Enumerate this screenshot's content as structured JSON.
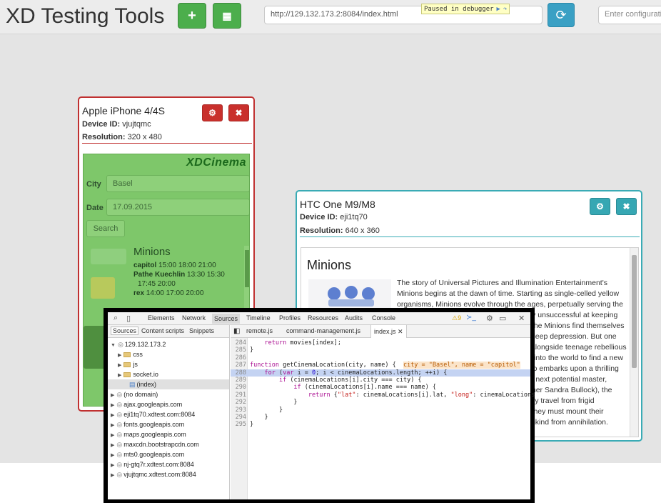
{
  "app": {
    "title": "XD Testing Tools",
    "add_icon": "+",
    "qr_icon": "▦",
    "url": "http://129.132.173.2:8084/index.html",
    "debug_badge": "Paused in debugger",
    "refresh_icon": "⟳",
    "config_placeholder": "Enter configuration"
  },
  "devices": [
    {
      "name": "Apple iPhone 4/4S",
      "device_id_label": "Device ID:",
      "device_id": "vjujtqmc",
      "resolution_label": "Resolution:",
      "resolution": "320 x 480",
      "accent": "#c03030"
    },
    {
      "name": "HTC One M9/M8",
      "device_id_label": "Device ID:",
      "device_id": "eji1tq70",
      "resolution_label": "Resolution:",
      "resolution": "640 x 360",
      "accent": "#3aabb5"
    }
  ],
  "cinema": {
    "logo": "XDCinema",
    "city_label": "City",
    "city_value": "Basel",
    "date_label": "Date",
    "date_value": "17.09.2015",
    "search_label": "Search",
    "movie_title": "Minions",
    "schedule": [
      {
        "venue": "capitol",
        "times": "15:00   18:00   21:00"
      },
      {
        "venue": "Pathe Kuechlin",
        "times": "13:30   15:30"
      },
      {
        "venue": "",
        "times": "17:45   20:00"
      },
      {
        "venue": "rex",
        "times": "14:00   17:00   20:00"
      }
    ]
  },
  "movie_detail": {
    "title": "Minions",
    "description": "The story of Universal Pictures and Illumination Entertainment's Minions begins at the dawn of time. Starting as single-celled yellow organisms, Minions evolve through the ages, perpetually serving the most despicable of masters. Continuously unsuccessful at keeping these masters—from T. rex to Napoleon-the Minions find themselves without someone to serve and fall into a deep depression. But one Minion named Kevin has a plan, and he-alongside teenage rebellious Stuart and lovable little Bob-ventures out into the world to find a new evil boss for his brethren to follow. The trio embarks upon a thrilling journey that ultimately leads them to their next potential master, Scarlet Overkill (Academy Award (R) winner Sandra Bullock), the world's first-ever female super-villain. They travel from frigid Antarctica to 1960s mod London, where they must mount their biggest challenge yet: saving all of Minionkind from annihilation."
  },
  "devtools": {
    "tabs": [
      "Elements",
      "Network",
      "Sources",
      "Timeline",
      "Profiles",
      "Resources",
      "Audits",
      "Console"
    ],
    "active_tab": "Sources",
    "warning_count": "9",
    "subtabs": [
      "Sources",
      "Content scripts",
      "Snippets"
    ],
    "file_tabs": [
      "remote.js",
      "command-management.js",
      "index.js"
    ],
    "active_file": "index.js",
    "tree": [
      {
        "label": "129.132.173.2",
        "level": 0,
        "type": "origin",
        "open": true
      },
      {
        "label": "css",
        "level": 1,
        "type": "folder"
      },
      {
        "label": "js",
        "level": 1,
        "type": "folder"
      },
      {
        "label": "socket.io",
        "level": 1,
        "type": "folder"
      },
      {
        "label": "(index)",
        "level": 1,
        "type": "file",
        "selected": true
      },
      {
        "label": "(no domain)",
        "level": 0,
        "type": "origin"
      },
      {
        "label": "ajax.googleapis.com",
        "level": 0,
        "type": "origin"
      },
      {
        "label": "eji1tq70.xdtest.com:8084",
        "level": 0,
        "type": "origin"
      },
      {
        "label": "fonts.googleapis.com",
        "level": 0,
        "type": "origin"
      },
      {
        "label": "maps.googleapis.com",
        "level": 0,
        "type": "origin"
      },
      {
        "label": "maxcdn.bootstrapcdn.com",
        "level": 0,
        "type": "origin"
      },
      {
        "label": "mts0.googleapis.com",
        "level": 0,
        "type": "origin"
      },
      {
        "label": "nj-gtq7r.xdtest.com:8084",
        "level": 0,
        "type": "origin"
      },
      {
        "label": "vjujtqmc.xdtest.com:8084",
        "level": 0,
        "type": "origin"
      }
    ],
    "code": [
      {
        "ln": "284",
        "html": "    <span class=\"kw\">return</span> movies[index];"
      },
      {
        "ln": "285",
        "html": "}"
      },
      {
        "ln": "286",
        "html": ""
      },
      {
        "ln": "287",
        "html": "<span class=\"kw\">function</span> getCinemaLocation(city, name) {  <span class=\"inl\">city = \"Basel\", name = \"capitol\"</span>"
      },
      {
        "ln": "288",
        "html": "    <span class=\"kw\">for</span> (<span class=\"kw\">var</span> i = <span class=\"fn\">0</span>; i &lt; cinemaLocations.length; ++i) {",
        "current": true
      },
      {
        "ln": "289",
        "html": "        <span class=\"kw\">if</span> (cinemaLocations[i].city === city) {"
      },
      {
        "ln": "290",
        "html": "            <span class=\"kw\">if</span> (cinemaLocations[i].name === name) {"
      },
      {
        "ln": "291",
        "html": "                <span class=\"kw\">return</span> {<span class=\"str\">\"lat\"</span>: cinemaLocations[i].lat, <span class=\"str\">\"long\"</span>: cinemaLocations"
      },
      {
        "ln": "292",
        "html": "            }"
      },
      {
        "ln": "293",
        "html": "        }"
      },
      {
        "ln": "294",
        "html": "    }"
      },
      {
        "ln": "295",
        "html": "}"
      }
    ]
  }
}
